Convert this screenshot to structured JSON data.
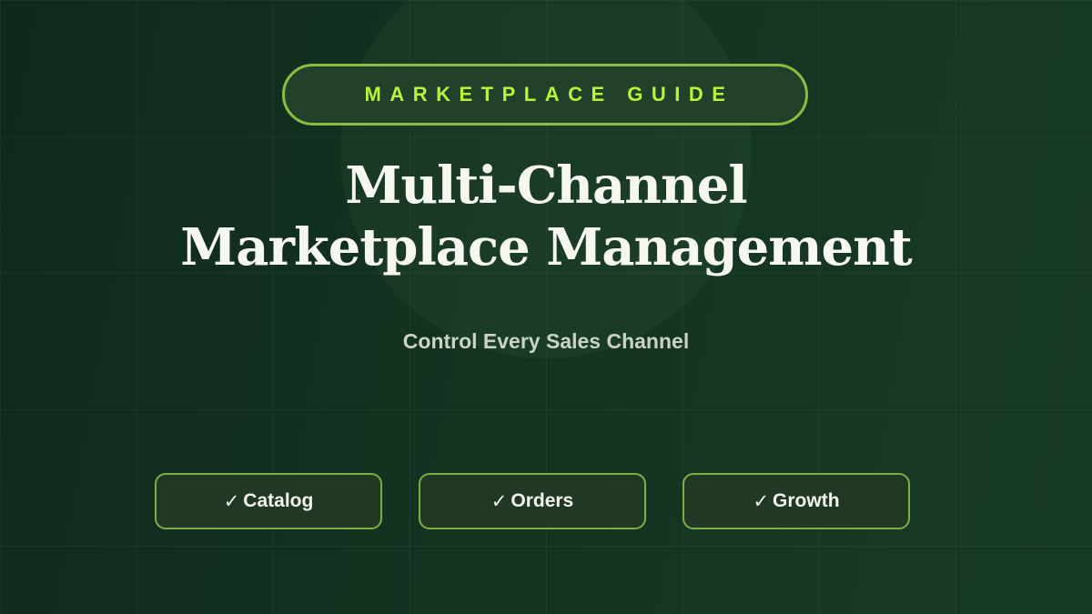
{
  "badge": {
    "label": "MARKETPLACE GUIDE"
  },
  "title": {
    "line1": "Multi-Channel",
    "line2": "Marketplace Management"
  },
  "subtitle": "Control Every Sales Channel",
  "features": [
    {
      "icon": "checkmark-icon",
      "check": "✓",
      "label": "Catalog"
    },
    {
      "icon": "checkmark-icon",
      "check": "✓",
      "label": "Orders"
    },
    {
      "icon": "checkmark-icon",
      "check": "✓",
      "label": "Growth"
    }
  ],
  "colors": {
    "background": "#143321",
    "accent": "#b8f53a",
    "border": "#8bbd3f",
    "title": "#f7f7f2",
    "subtitle": "#c9d3c7"
  }
}
